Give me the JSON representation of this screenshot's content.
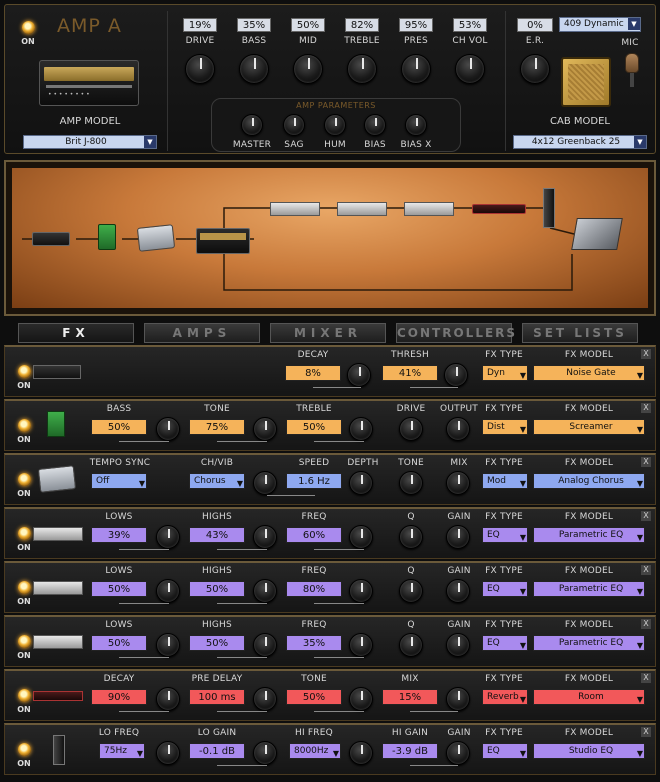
{
  "amp": {
    "title": "AMP A",
    "power_label": "ON",
    "model_label": "AMP MODEL",
    "model_value": "Brit J-800",
    "drive": {
      "label": "DRIVE",
      "value": "19%"
    },
    "bass": {
      "label": "BASS",
      "value": "35%"
    },
    "mid": {
      "label": "MID",
      "value": "50%"
    },
    "treble": {
      "label": "TREBLE",
      "value": "82%"
    },
    "pres": {
      "label": "PRES",
      "value": "95%"
    },
    "chvol": {
      "label": "CH VOL",
      "value": "53%"
    },
    "er": {
      "label": "E.R.",
      "value": "0%"
    },
    "mic_select": "409 Dynamic",
    "mic_label": "MIC",
    "params_title": "AMP PARAMETERS",
    "params": [
      "MASTER",
      "SAG",
      "HUM",
      "BIAS",
      "BIAS X"
    ],
    "cab_label": "CAB MODEL",
    "cab_value": "4x12 Greenback 25"
  },
  "tabs": [
    "FX",
    "AMPS",
    "MIXER",
    "CONTROLLERS",
    "SET LISTS"
  ],
  "fx_rows": [
    {
      "on": "ON",
      "params": [
        {
          "label": "DECAY",
          "value": "8%"
        },
        {
          "label": "THRESH",
          "value": "41%"
        }
      ],
      "fx_type_label": "FX TYPE",
      "fx_type": "Dyn",
      "fx_model_label": "FX MODEL",
      "fx_model": "Noise Gate"
    },
    {
      "on": "ON",
      "params": [
        {
          "label": "BASS",
          "value": "50%"
        },
        {
          "label": "TONE",
          "value": "75%"
        },
        {
          "label": "TREBLE",
          "value": "50%"
        },
        {
          "label": "DRIVE"
        },
        {
          "label": "OUTPUT"
        }
      ],
      "fx_type_label": "FX TYPE",
      "fx_type": "Dist",
      "fx_model_label": "FX MODEL",
      "fx_model": "Screamer"
    },
    {
      "on": "ON",
      "params": [
        {
          "label": "TEMPO SYNC",
          "value": "Off"
        },
        {
          "label": "CH/VIB",
          "value": "Chorus"
        },
        {
          "label": "SPEED",
          "value": "1.6 Hz"
        },
        {
          "label": "DEPTH"
        },
        {
          "label": "TONE"
        },
        {
          "label": "MIX"
        }
      ],
      "fx_type_label": "FX TYPE",
      "fx_type": "Mod",
      "fx_model_label": "FX MODEL",
      "fx_model": "Analog Chorus"
    },
    {
      "on": "ON",
      "params": [
        {
          "label": "LOWS",
          "value": "39%"
        },
        {
          "label": "HIGHS",
          "value": "43%"
        },
        {
          "label": "FREQ",
          "value": "60%"
        },
        {
          "label": "Q"
        },
        {
          "label": "GAIN"
        }
      ],
      "fx_type_label": "FX TYPE",
      "fx_type": "EQ",
      "fx_model_label": "FX MODEL",
      "fx_model": "Parametric EQ"
    },
    {
      "on": "ON",
      "params": [
        {
          "label": "LOWS",
          "value": "50%"
        },
        {
          "label": "HIGHS",
          "value": "50%"
        },
        {
          "label": "FREQ",
          "value": "80%"
        },
        {
          "label": "Q"
        },
        {
          "label": "GAIN"
        }
      ],
      "fx_type_label": "FX TYPE",
      "fx_type": "EQ",
      "fx_model_label": "FX MODEL",
      "fx_model": "Parametric EQ"
    },
    {
      "on": "ON",
      "params": [
        {
          "label": "LOWS",
          "value": "50%"
        },
        {
          "label": "HIGHS",
          "value": "50%"
        },
        {
          "label": "FREQ",
          "value": "35%"
        },
        {
          "label": "Q"
        },
        {
          "label": "GAIN"
        }
      ],
      "fx_type_label": "FX TYPE",
      "fx_type": "EQ",
      "fx_model_label": "FX MODEL",
      "fx_model": "Parametric EQ"
    },
    {
      "on": "ON",
      "params": [
        {
          "label": "DECAY",
          "value": "90%"
        },
        {
          "label": "PRE DELAY",
          "value": "100 ms"
        },
        {
          "label": "TONE",
          "value": "50%"
        },
        {
          "label": "MIX",
          "value": "15%"
        }
      ],
      "fx_type_label": "FX TYPE",
      "fx_type": "Reverb",
      "fx_model_label": "FX MODEL",
      "fx_model": "Room"
    },
    {
      "on": "ON",
      "params": [
        {
          "label": "LO FREQ",
          "value": "75Hz"
        },
        {
          "label": "LO GAIN",
          "value": "-0.1 dB"
        },
        {
          "label": "HI FREQ",
          "value": "8000Hz"
        },
        {
          "label": "HI GAIN",
          "value": "-3.9 dB"
        },
        {
          "label": "GAIN"
        }
      ],
      "fx_type_label": "FX TYPE",
      "fx_type": "EQ",
      "fx_model_label": "FX MODEL",
      "fx_model": "Studio EQ"
    }
  ],
  "colors": {
    "orange": "#f5b35a",
    "purple": "#a98aee",
    "blue": "#8ea8f0",
    "red": "#f2585a"
  }
}
